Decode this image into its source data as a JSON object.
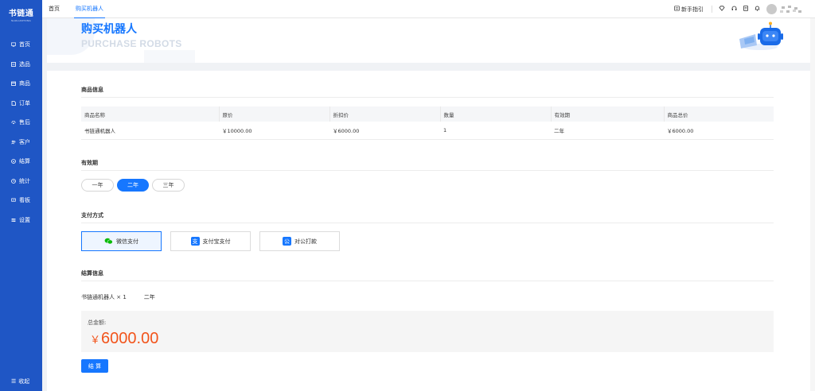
{
  "logo": {
    "main": "书链通",
    "sub": "SHULIANTONG"
  },
  "sidebar": {
    "items": [
      {
        "label": "首页",
        "icon": "monitor-icon"
      },
      {
        "label": "选品",
        "icon": "select-icon"
      },
      {
        "label": "商品",
        "icon": "goods-icon"
      },
      {
        "label": "订单",
        "icon": "order-icon"
      },
      {
        "label": "售后",
        "icon": "aftersale-icon"
      },
      {
        "label": "客户",
        "icon": "customer-icon"
      },
      {
        "label": "结算",
        "icon": "settle-icon"
      },
      {
        "label": "统计",
        "icon": "stats-icon"
      },
      {
        "label": "看板",
        "icon": "board-icon"
      },
      {
        "label": "设置",
        "icon": "settings-icon"
      }
    ],
    "collapse_label": "收起"
  },
  "topbar": {
    "tabs": [
      {
        "label": "首页"
      },
      {
        "label": "购买机器人"
      }
    ],
    "guide_label": "新手指引"
  },
  "header": {
    "title_cn": "购买机器人",
    "title_en": "PURCHASE ROBOTS"
  },
  "product_info": {
    "title": "商品信息",
    "columns": [
      "商品名称",
      "原价",
      "折扣价",
      "数量",
      "有效期",
      "商品总价"
    ],
    "row": [
      "书链通机器人",
      "￥10000.00",
      "￥6000.00",
      "1",
      "二年",
      "￥6000.00"
    ]
  },
  "validity": {
    "title": "有效期",
    "options": [
      "一年",
      "二年",
      "三年"
    ],
    "selected": "二年"
  },
  "payment": {
    "title": "支付方式",
    "options": [
      {
        "label": "微信支付",
        "icon": "wechat-icon",
        "color": "#09bb07"
      },
      {
        "label": "支付宝支付",
        "icon": "alipay-icon",
        "color": "#1677ff"
      },
      {
        "label": "对公打款",
        "icon": "bank-transfer-icon",
        "color": "#1677ff"
      }
    ],
    "selected": "微信支付"
  },
  "settlement": {
    "title": "结算信息",
    "item": "书链通机器人 × 1",
    "period": "二年",
    "total_label": "总金额:",
    "currency": "￥",
    "amount": "6000.00",
    "button_label": "结 算"
  },
  "colors": {
    "sidebar_bg": "#1f56c5",
    "accent": "#1677ff",
    "price": "#f2541b"
  }
}
